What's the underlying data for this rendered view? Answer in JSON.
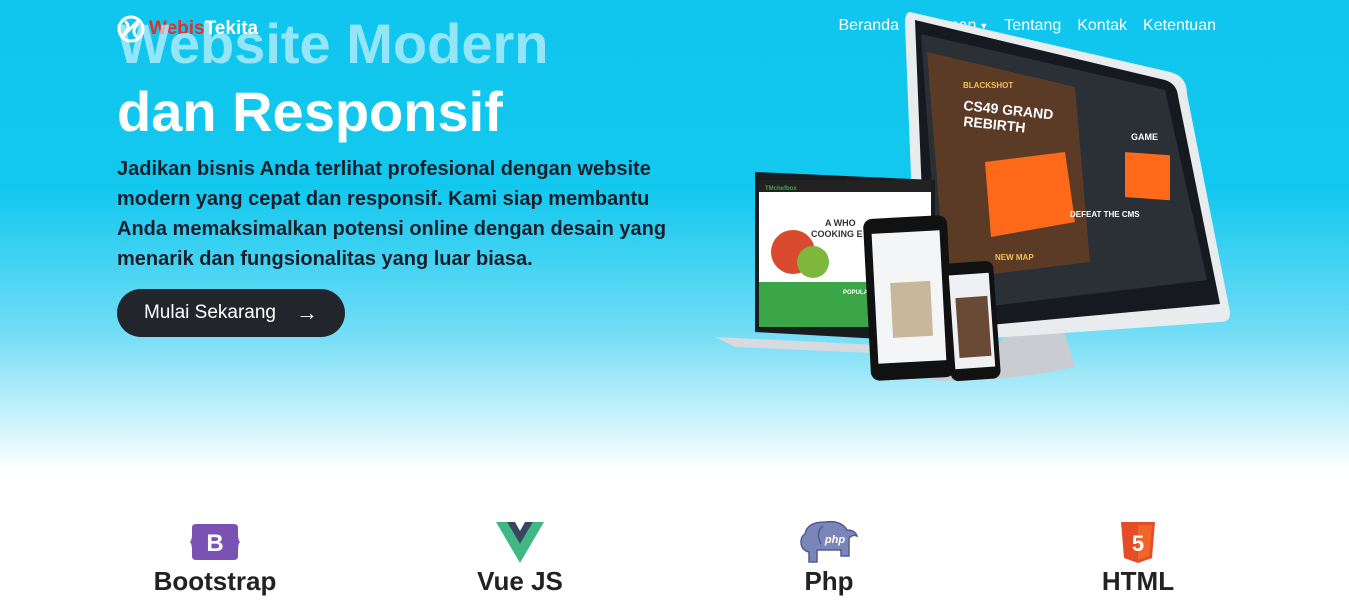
{
  "brand": {
    "part1": "Webis",
    "part2": "Tekita"
  },
  "nav": {
    "items": [
      "Beranda",
      "Layanan",
      "Tentang",
      "Kontak",
      "Ketentuan"
    ]
  },
  "hero": {
    "title_line1": "Website Modern",
    "title_line2": "dan Responsif",
    "lead": "Jadikan bisnis Anda terlihat profesional dengan website modern yang cepat dan responsif. Kami siap membantu Anda memaksimalkan potensi online dengan desain yang menarik dan fungsionalitas yang luar biasa.",
    "cta_label": "Mulai Sekarang",
    "mockup": {
      "desktop_line1": "BLACKSHOT",
      "desktop_line2": "CS49 GRAND",
      "desktop_line3": "REBIRTH",
      "desktop_badge": "GAME",
      "desktop_sub": "DEFEAT THE CMS",
      "desktop_map": "NEW MAP",
      "laptop_brand": "TMchefbox",
      "laptop_headline1": "A WHO",
      "laptop_headline2": "COOKING E",
      "laptop_popular": "POPULA"
    }
  },
  "tech": [
    {
      "label": "Bootstrap",
      "icon": "bootstrap-icon",
      "glyph": "B",
      "color": "#7952b3"
    },
    {
      "label": "Vue JS",
      "icon": "vue-icon",
      "color": "#41b883"
    },
    {
      "label": "Php",
      "icon": "php-elephant-icon",
      "glyph": "php",
      "color": "#7a86b8"
    },
    {
      "label": "HTML",
      "icon": "html5-icon",
      "glyph": "5",
      "color": "#e44d26"
    }
  ]
}
